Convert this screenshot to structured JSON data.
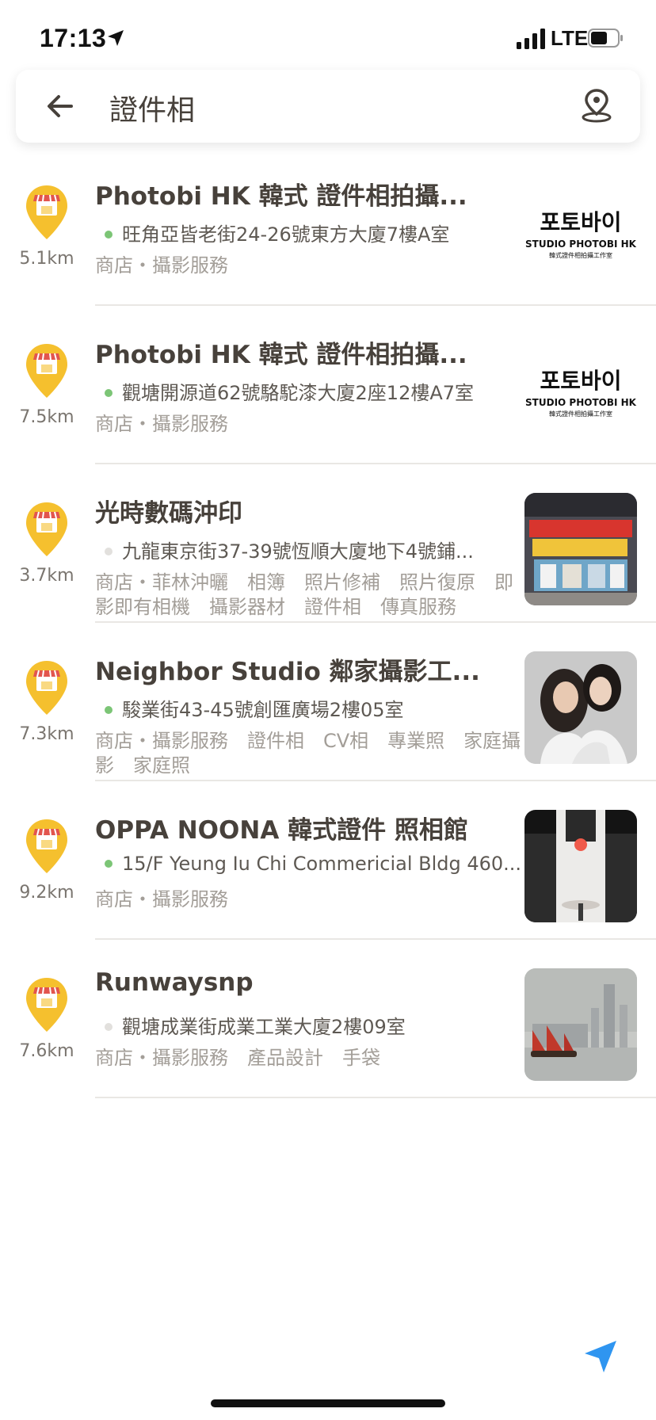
{
  "status": {
    "time": "17:13",
    "network": "LTE"
  },
  "search": {
    "query": "證件相"
  },
  "results": [
    {
      "name": "Photobi HK 韓式 證件相拍攝...",
      "address": "旺角亞皆老街24-26號東方大廈7樓A室",
      "distance": "5.1km",
      "tags": "商店・攝影服務",
      "dot_color": "#7cc576",
      "logo": {
        "ko": "포토바이",
        "en": "STUDIO PHOTOBI HK",
        "sub": "韓式證件相拍攝工作室"
      }
    },
    {
      "name": "Photobi HK 韓式 證件相拍攝...",
      "address": "觀塘開源道62號駱駝漆大廈2座12樓A7室",
      "distance": "7.5km",
      "tags": "商店・攝影服務",
      "dot_color": "#7cc576",
      "logo": {
        "ko": "포토바이",
        "en": "STUDIO PHOTOBI HK",
        "sub": "韓式證件相拍攝工作室"
      }
    },
    {
      "name": "光時數碼沖印",
      "address": "九龍東京街37-39號恆順大廈地下4號鋪...",
      "distance": "3.7km",
      "tags": "商店・菲林沖曬　相簿　照片修補　照片復原　即影即有相機　攝影器材　證件相　傳真服務",
      "dot_color": "#e2e0dd"
    },
    {
      "name": "Neighbor Studio 鄰家攝影工...",
      "address": "駿業街43-45號創匯廣場2樓05室",
      "distance": "7.3km",
      "tags": "商店・攝影服務　證件相　CV相　專業照　家庭攝影　家庭照",
      "dot_color": "#7cc576"
    },
    {
      "name": "OPPA NOONA 韓式證件 照相館",
      "address": "15/F Yeung Iu Chi Commericial Bldg 460...",
      "distance": "9.2km",
      "tags": "商店・攝影服務",
      "dot_color": "#7cc576"
    },
    {
      "name": "Runwaysnp",
      "address": "觀塘成業街成業工業大廈2樓09室",
      "distance": "7.6km",
      "tags": "商店・攝影服務　產品設計　手袋",
      "dot_color": "#e2e0dd"
    }
  ],
  "colors": {
    "accent": "#2f95f0",
    "pin": "#f5c02e",
    "awning_red": "#e2554e"
  }
}
